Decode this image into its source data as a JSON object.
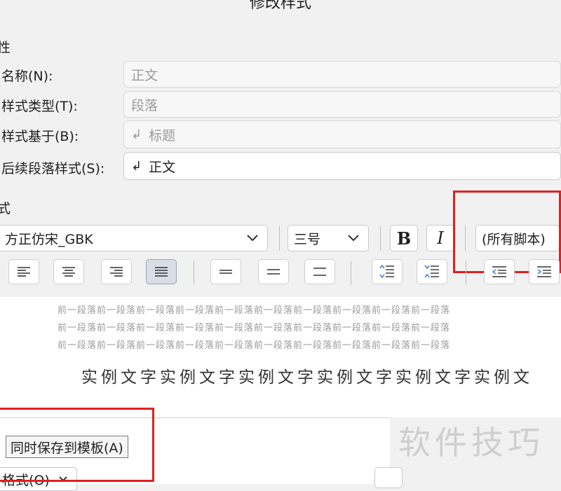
{
  "dialog": {
    "title": "修改样式"
  },
  "properties": {
    "section_label": "性",
    "name": {
      "label": "名称(N):",
      "value": "正文"
    },
    "style_type": {
      "label": "样式类型(T):",
      "value": "段落"
    },
    "based_on": {
      "label": "样式基于(B):",
      "value": "标题",
      "mark": "↲"
    },
    "next_style": {
      "label": "后续段落样式(S):",
      "value": "正文",
      "mark": "↲"
    }
  },
  "format": {
    "section_label": "式",
    "font": "方正仿宋_GBK",
    "size": "三号",
    "bold_label": "B",
    "italic_label": "I",
    "script": "(所有脚本)"
  },
  "preview": {
    "prev_lines": [
      "前一段落前一段落前一段落前一段落前一段落前一段落前一段落前一段落前一段落前一段落",
      "前一段落前一段落前一段落前一段落前一段落前一段落前一段落前一段落前一段落前一段落",
      "前一段落前一段落前一段落前一段落前一段落前一段落前一段落前一段落前一段落前一段落"
    ],
    "sample_text": "实例文字实例文字实例文字实例文字实例文字实例文"
  },
  "footer": {
    "save_to_template": "同时保存到模板(A)",
    "format_menu": "格式(O)"
  },
  "watermark": "软件技巧",
  "colors": {
    "highlight": "#e02020",
    "pressed_button": "#d9dde6"
  }
}
